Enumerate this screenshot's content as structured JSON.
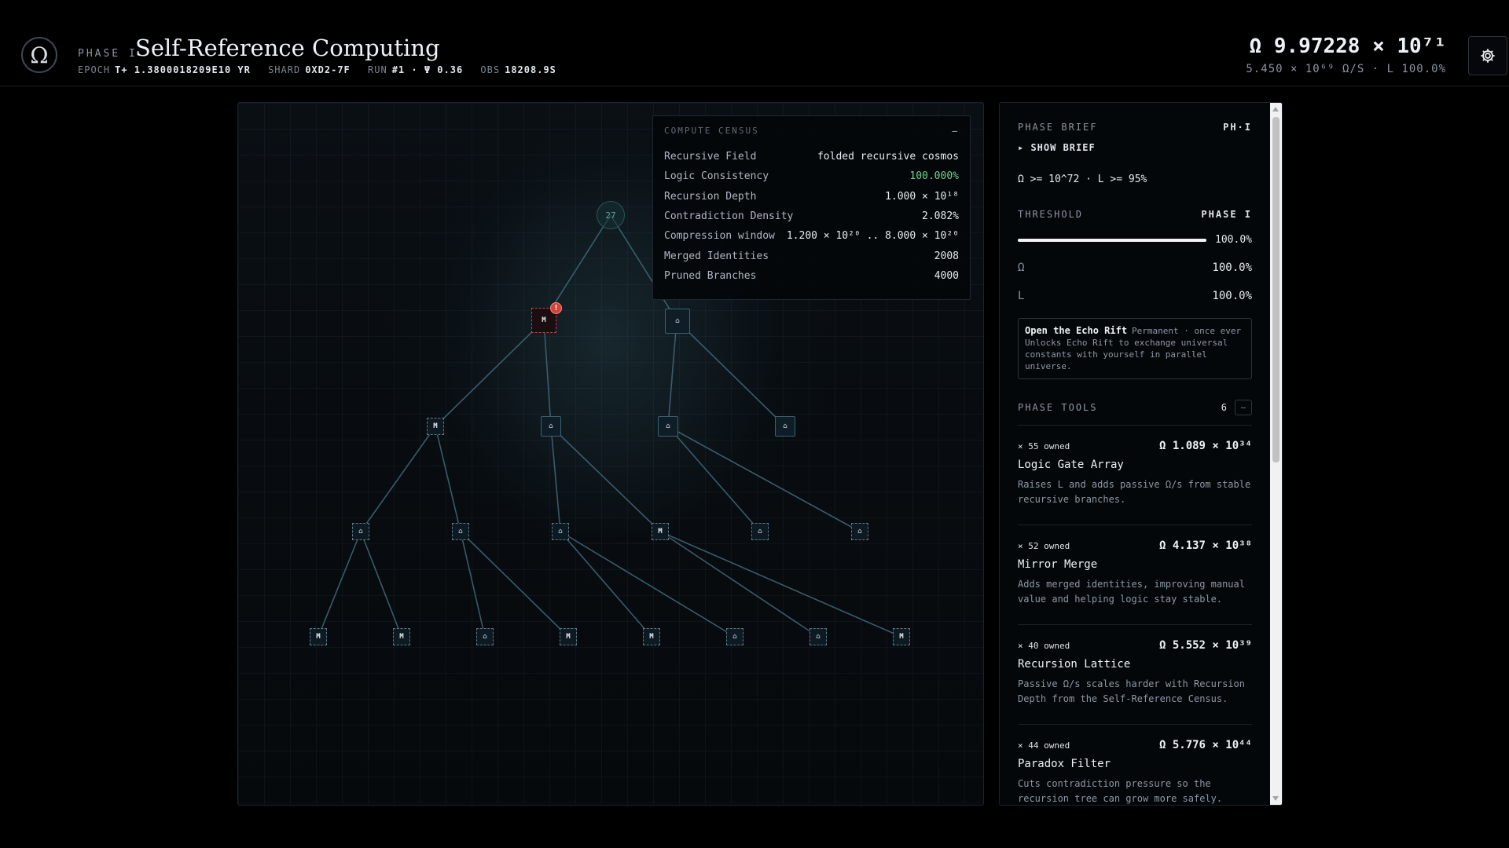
{
  "header": {
    "logo_glyph": "Ω",
    "phase_label": "PHASE I",
    "title": "Self-Reference Computing",
    "epoch_key": "EPOCH",
    "epoch_value": "T+ 1.3800018209E10 YR",
    "shard_key": "SHARD",
    "shard_value": "0XD2-7F",
    "run_key": "RUN",
    "run_value": "#1 · Ψ 0.36",
    "obs_key": "OBS",
    "obs_value": "18208.9S",
    "omega_total": "Ω 9.97228 × 10⁷¹",
    "omega_rate": "5.450 × 10⁶⁹ Ω/S · L 100.0%"
  },
  "tree": {
    "root_label": "27",
    "nodes": {
      "l1a": "M",
      "l1b": "⌂",
      "l2a": "M",
      "l2b": "⌂",
      "l2c": "⌂",
      "l2d": "⌂",
      "l3a": "⌂",
      "l3b": "⌂",
      "l3c": "⌂",
      "l3d": "M",
      "l3e": "⌂",
      "l3f": "⌂",
      "l4a": "M",
      "l4b": "M",
      "l4c": "⌂",
      "l4d": "M",
      "l4e": "M",
      "l4f": "⌂",
      "l4g": "⌂",
      "l4h": "M"
    },
    "alert_glyph": "!"
  },
  "census": {
    "title": "COMPUTE CENSUS",
    "collapse": "–",
    "rows": [
      {
        "label": "Recursive Field",
        "value": "folded recursive cosmos"
      },
      {
        "label": "Logic Consistency",
        "value": "100.000%"
      },
      {
        "label": "Recursion Depth",
        "value": "1.000 × 10¹⁸"
      },
      {
        "label": "Contradiction Density",
        "value": "2.082%"
      },
      {
        "label": "Compression window",
        "value": "1.200 × 10²⁰ .. 8.000 × 10²⁰"
      },
      {
        "label": "Merged Identities",
        "value": "2008"
      },
      {
        "label": "Pruned Branches",
        "value": "4000"
      }
    ],
    "accent_green": "#6fd38e"
  },
  "panel": {
    "brief_head": "PHASE BRIEF",
    "brief_tag": "PH·I",
    "show_brief": "▸ SHOW BRIEF",
    "goal": "Ω >= 10^72 · L >= 95%",
    "threshold_head": "THRESHOLD",
    "threshold_tag": "PHASE I",
    "threshold_value": "100.0%",
    "threshold_fill": 1.0,
    "omega_key": "Ω",
    "omega_value": "100.0%",
    "l_key": "L",
    "l_value": "100.0%",
    "rift_title": "Open the Echo Rift",
    "rift_text": "Permanent · once ever Unlocks Echo Rift to exchange universal constants with yourself in parallel universe.",
    "tools_head": "PHASE TOOLS",
    "tools_count": "6",
    "tools_toggle": "–",
    "tools": [
      {
        "owned": "× 55 owned",
        "cost": "Ω 1.089 × 10³⁴",
        "name": "Logic Gate Array",
        "desc": "Raises L and adds passive Ω/s from stable recursive branches."
      },
      {
        "owned": "× 52 owned",
        "cost": "Ω 4.137 × 10³⁸",
        "name": "Mirror Merge",
        "desc": "Adds merged identities, improving manual value and helping logic stay stable."
      },
      {
        "owned": "× 40 owned",
        "cost": "Ω 5.552 × 10³⁹",
        "name": "Recursion Lattice",
        "desc": "Passive Ω/s scales harder with Recursion Depth from the Self-Reference Census."
      },
      {
        "owned": "× 44 owned",
        "cost": "Ω 5.776 × 10⁴⁴",
        "name": "Paradox Filter",
        "desc": "Cuts contradiction pressure so the recursion tree can grow more safely."
      }
    ]
  }
}
